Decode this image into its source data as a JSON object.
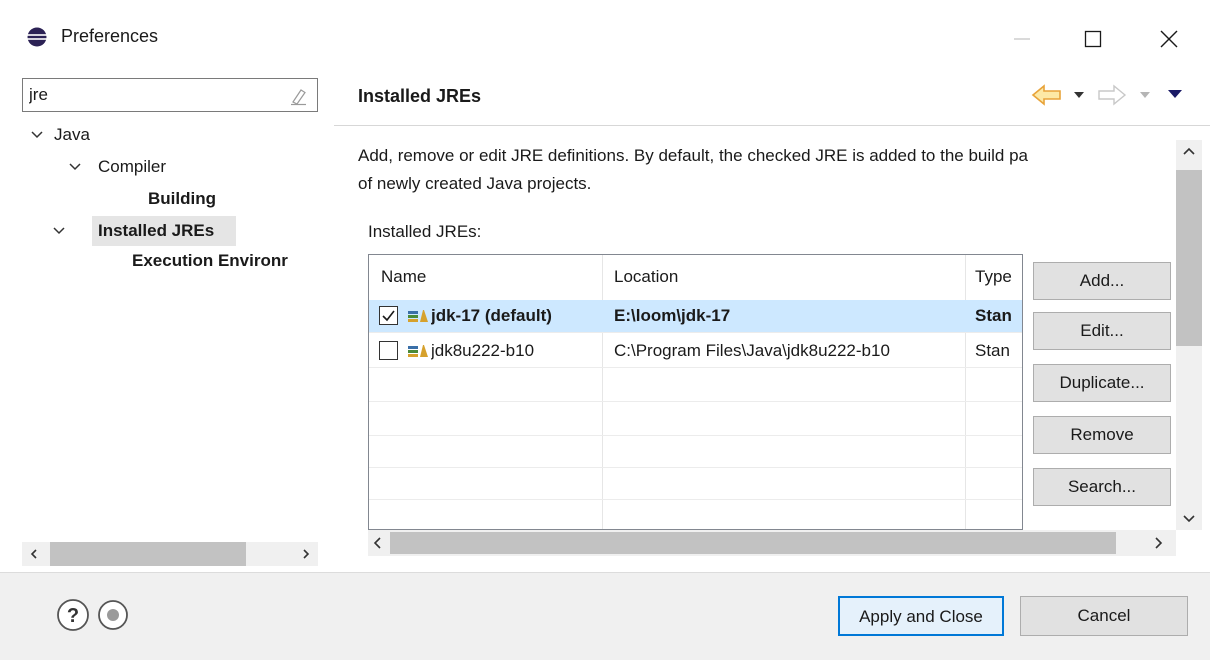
{
  "window": {
    "title": "Preferences",
    "minimize_glyph": "—",
    "maximize_glyph": "☐",
    "close_glyph": "✕"
  },
  "filter": {
    "value": "jre",
    "placeholder": ""
  },
  "tree": {
    "items": [
      {
        "label": "Java",
        "expanded": true
      },
      {
        "label": "Compiler",
        "expanded": true
      },
      {
        "label": "Building"
      },
      {
        "label": "Installed JREs",
        "selected": true,
        "expanded": true
      },
      {
        "label": "Execution Environr"
      }
    ]
  },
  "page": {
    "title": "Installed JREs",
    "description_line1": "Add, remove or edit JRE definitions. By default, the checked JRE is added to the build pa",
    "description_line2": "of newly created Java projects.",
    "table_label": "Installed JREs:",
    "columns": [
      "Name",
      "Location",
      "Type"
    ],
    "rows": [
      {
        "checked": true,
        "default": true,
        "name": "jdk-17 (default)",
        "location": "E:\\loom\\jdk-17",
        "type": "Stan"
      },
      {
        "checked": false,
        "default": false,
        "name": "jdk8u222-b10",
        "location": "C:\\Program Files\\Java\\jdk8u222-b10",
        "type": "Stan"
      }
    ],
    "buttons": {
      "add": "Add...",
      "edit": "Edit...",
      "duplicate": "Duplicate...",
      "remove": "Remove",
      "search": "Search..."
    }
  },
  "footer": {
    "apply_close": "Apply and Close",
    "cancel": "Cancel"
  },
  "colors": {
    "selection": "#cde8ff",
    "tree_selection": "#e5e5e5",
    "nav_arrow": "#e8a33a",
    "focus_border": "#0078d7"
  }
}
